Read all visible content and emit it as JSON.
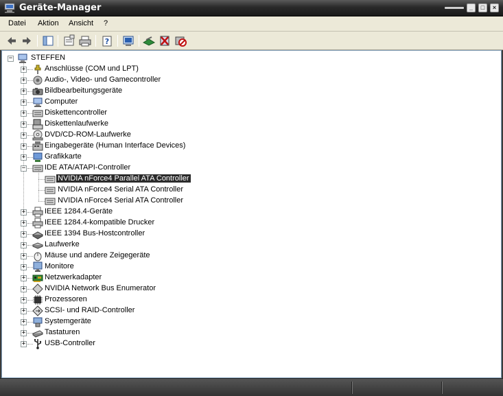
{
  "window": {
    "title": "Geräte-Manager"
  },
  "menu": [
    "Datei",
    "Aktion",
    "Ansicht",
    "?"
  ],
  "toolbar": [
    {
      "name": "back-arrow-icon"
    },
    {
      "name": "forward-arrow-icon"
    },
    {
      "name": "show-hide-console-tree-icon"
    },
    {
      "name": "properties-icon"
    },
    {
      "name": "print-icon"
    },
    {
      "name": "help-icon"
    },
    {
      "name": "scan-hardware-icon"
    },
    {
      "name": "update-driver-icon"
    },
    {
      "name": "uninstall-icon"
    },
    {
      "name": "disable-icon"
    }
  ],
  "tree": {
    "root": "STEFFEN",
    "categories": [
      {
        "label": "Anschlüsse (COM und LPT)",
        "icon": "port-icon",
        "expanded": false
      },
      {
        "label": "Audio-, Video- und Gamecontroller",
        "icon": "speaker-icon",
        "expanded": false
      },
      {
        "label": "Bildbearbeitungsgeräte",
        "icon": "camera-icon",
        "expanded": false
      },
      {
        "label": "Computer",
        "icon": "computer-icon",
        "expanded": false
      },
      {
        "label": "Diskettencontroller",
        "icon": "controller-icon",
        "expanded": false
      },
      {
        "label": "Diskettenlaufwerke",
        "icon": "floppy-icon",
        "expanded": false
      },
      {
        "label": "DVD/CD-ROM-Laufwerke",
        "icon": "cd-drive-icon",
        "expanded": false
      },
      {
        "label": "Eingabegeräte (Human Interface Devices)",
        "icon": "hid-icon",
        "expanded": false
      },
      {
        "label": "Grafikkarte",
        "icon": "display-adapter-icon",
        "expanded": false
      },
      {
        "label": "IDE ATA/ATAPI-Controller",
        "icon": "controller-icon",
        "expanded": true,
        "children": [
          {
            "label": "NVIDIA nForce4 Parallel ATA Controller",
            "selected": true
          },
          {
            "label": "NVIDIA nForce4 Serial ATA Controller",
            "selected": false
          },
          {
            "label": "NVIDIA nForce4 Serial ATA Controller",
            "selected": false
          }
        ]
      },
      {
        "label": "IEEE 1284.4-Geräte",
        "icon": "printer-icon",
        "expanded": false
      },
      {
        "label": "IEEE 1284.4-kompatible Drucker",
        "icon": "printer-icon",
        "expanded": false
      },
      {
        "label": "IEEE 1394 Bus-Hostcontroller",
        "icon": "firewire-icon",
        "expanded": false
      },
      {
        "label": "Laufwerke",
        "icon": "disk-drive-icon",
        "expanded": false
      },
      {
        "label": "Mäuse und andere Zeigegeräte",
        "icon": "mouse-icon",
        "expanded": false
      },
      {
        "label": "Monitore",
        "icon": "monitor-icon",
        "expanded": false
      },
      {
        "label": "Netzwerkadapter",
        "icon": "network-card-icon",
        "expanded": false
      },
      {
        "label": "NVIDIA Network Bus Enumerator",
        "icon": "network-bus-icon",
        "expanded": false
      },
      {
        "label": "Prozessoren",
        "icon": "processor-icon",
        "expanded": false
      },
      {
        "label": "SCSI- und RAID-Controller",
        "icon": "scsi-icon",
        "expanded": false
      },
      {
        "label": "Systemgeräte",
        "icon": "system-device-icon",
        "expanded": false
      },
      {
        "label": "Tastaturen",
        "icon": "keyboard-icon",
        "expanded": false
      },
      {
        "label": "USB-Controller",
        "icon": "usb-icon",
        "expanded": false
      }
    ]
  }
}
